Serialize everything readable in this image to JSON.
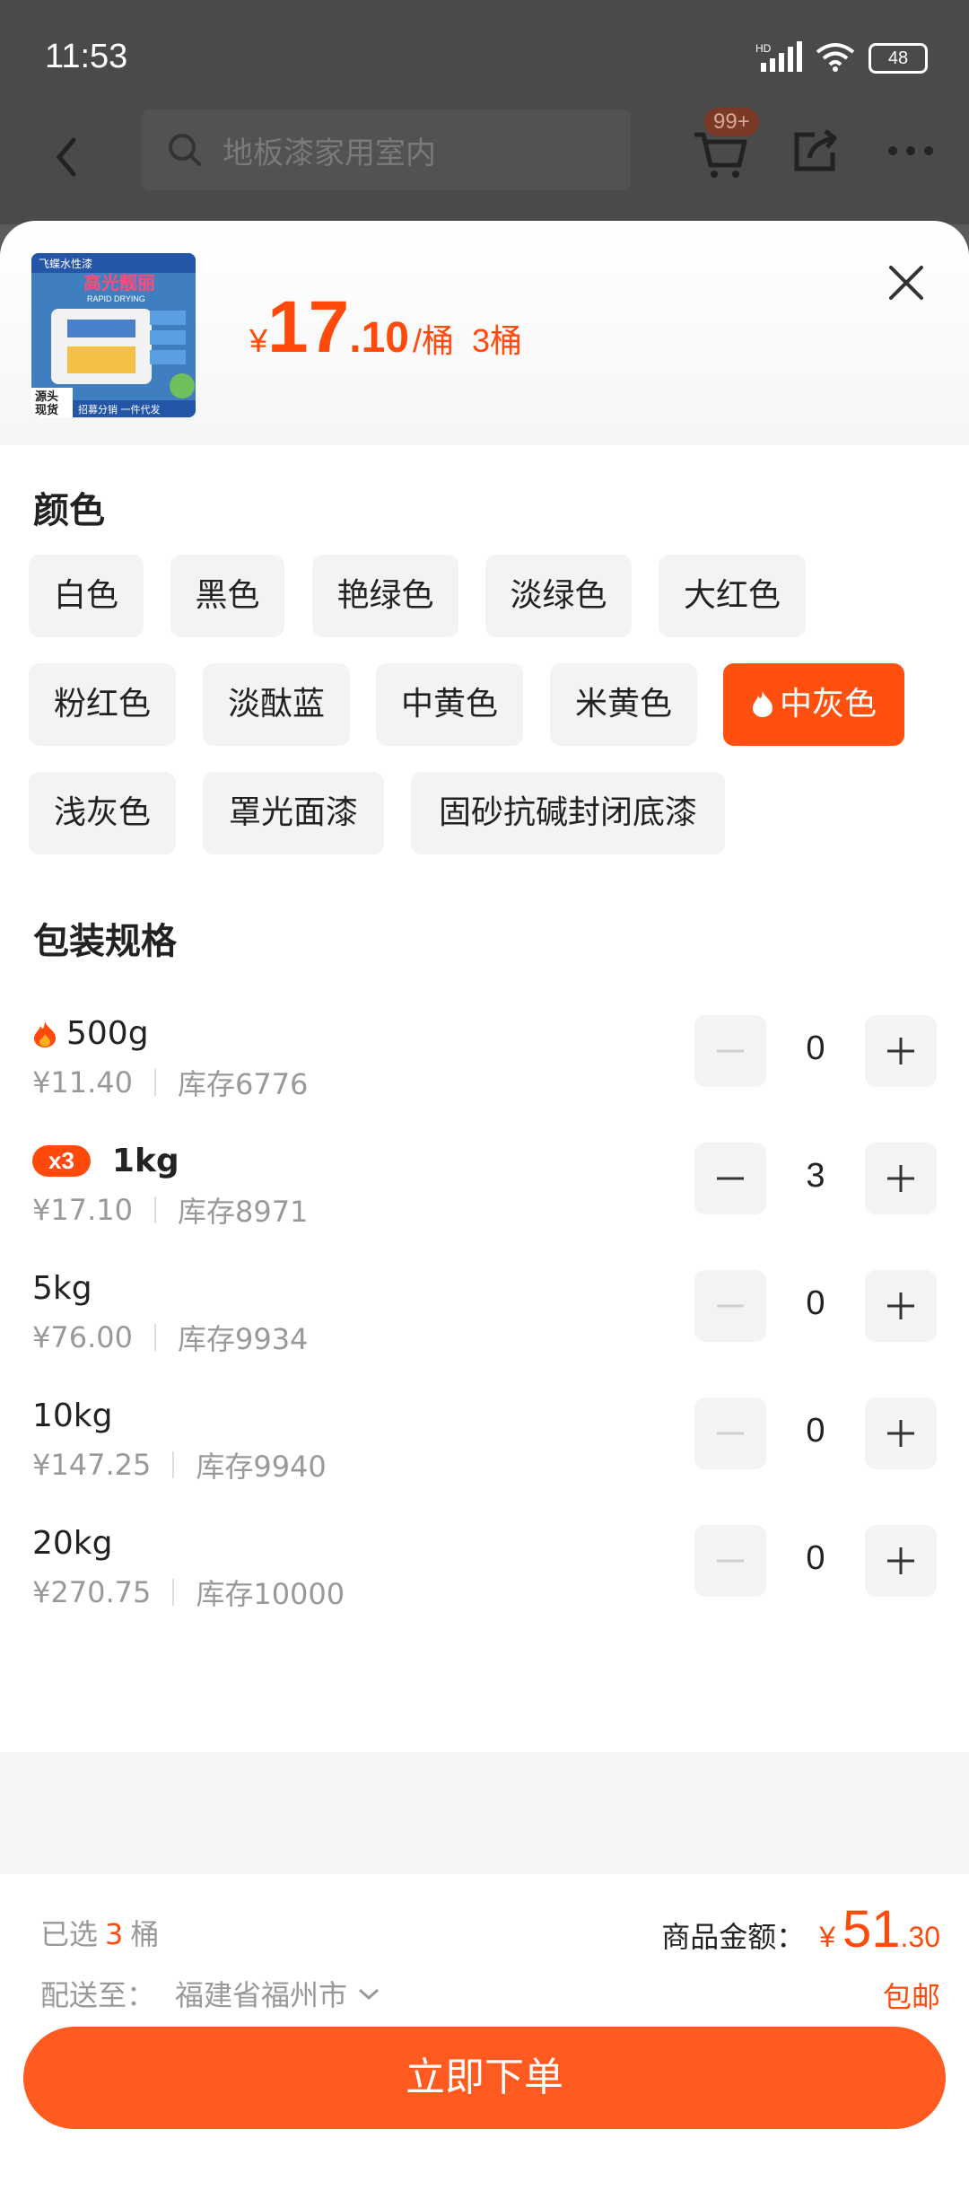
{
  "status": {
    "time": "11:53",
    "battery": "48",
    "network": "HD"
  },
  "nav": {
    "search_placeholder": "地板漆家用室内",
    "cart_badge": "99+"
  },
  "product": {
    "price_currency": "¥",
    "price_int": "17",
    "price_dec": ".10",
    "price_unit": "/桶",
    "selected_qty": "3桶",
    "thumb_texts": {
      "brand": "高光靓丽",
      "subtitle": "RAPID DRYING",
      "left_tag": "源头现货",
      "bottom": "招募分销  一件代发"
    }
  },
  "color_section": {
    "title": "颜色",
    "options": [
      {
        "label": "白色",
        "selected": false
      },
      {
        "label": "黑色",
        "selected": false
      },
      {
        "label": "艳绿色",
        "selected": false
      },
      {
        "label": "淡绿色",
        "selected": false
      },
      {
        "label": "大红色",
        "selected": false
      },
      {
        "label": "粉红色",
        "selected": false
      },
      {
        "label": "淡酞蓝",
        "selected": false
      },
      {
        "label": "中黄色",
        "selected": false
      },
      {
        "label": "米黄色",
        "selected": false
      },
      {
        "label": "中灰色",
        "selected": true
      },
      {
        "label": "浅灰色",
        "selected": false
      },
      {
        "label": "罩光面漆",
        "selected": false
      },
      {
        "label": "固砂抗碱封闭底漆",
        "selected": false
      }
    ]
  },
  "spec_section": {
    "title": "包装规格",
    "items": [
      {
        "name": "500g",
        "price": "¥11.40",
        "stock": "库存6776",
        "count": "0",
        "hot": true,
        "badge": ""
      },
      {
        "name": "1kg",
        "price": "¥17.10",
        "stock": "库存8971",
        "count": "3",
        "hot": false,
        "badge": "x3"
      },
      {
        "name": "5kg",
        "price": "¥76.00",
        "stock": "库存9934",
        "count": "0",
        "hot": false,
        "badge": ""
      },
      {
        "name": "10kg",
        "price": "¥147.25",
        "stock": "库存9940",
        "count": "0",
        "hot": false,
        "badge": ""
      },
      {
        "name": "20kg",
        "price": "¥270.75",
        "stock": "库存10000",
        "count": "0",
        "hot": false,
        "badge": ""
      }
    ]
  },
  "footer": {
    "selected_prefix": "已选",
    "selected_num": "3",
    "selected_unit": "桶",
    "total_label": "商品金额：",
    "total_currency": "¥",
    "total_int": "51",
    "total_dec": ".30",
    "deliver_label": "配送至：",
    "deliver_city": "福建省福州市",
    "free_shipping": "包邮",
    "order_button": "立即下单"
  },
  "colors": {
    "accent": "#ff5010",
    "button": "#ff5a1f"
  }
}
